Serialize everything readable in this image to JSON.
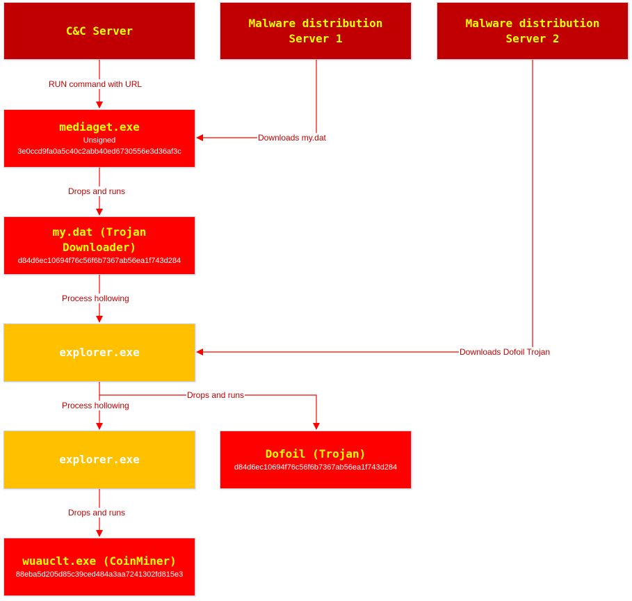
{
  "colors": {
    "server": "#c00000",
    "malware": "#ff0000",
    "process": "#ffc000",
    "title_text": "#ffff00",
    "process_title_text": "#ffffff",
    "hash_text": "#ffffff",
    "edge": "#ff0000",
    "edge_label": "#c00000"
  },
  "nodes": {
    "cc_server": {
      "title": "C&C Server"
    },
    "dist_server_1": {
      "title": "Malware distribution\nServer 1"
    },
    "dist_server_2": {
      "title": "Malware distribution\nServer 2"
    },
    "mediaget": {
      "title": "mediaget.exe",
      "signature": "Unsigned",
      "hash": "3e0ccd9fa0a5c40c2abb40ed6730556e3d36af3c"
    },
    "mydat": {
      "title": "my.dat (Trojan\nDownloader)",
      "hash": "d84d6ec10694f76c56f6b7367ab56ea1f743d284"
    },
    "explorer_1": {
      "title": "explorer.exe"
    },
    "explorer_2": {
      "title": "explorer.exe"
    },
    "dofoil": {
      "title": "Dofoil (Trojan)",
      "hash": "d84d6ec10694f76c56f6b7367ab56ea1f743d284"
    },
    "wuauclt": {
      "title": "wuauclt.exe (CoinMiner)",
      "hash": "88eba5d205d85c39ced484a3aa7241302fd815e3"
    }
  },
  "edges": [
    {
      "id": "cc-to-mediaget",
      "from": "cc_server",
      "to": "mediaget",
      "label": "RUN command with URL"
    },
    {
      "id": "dist1-to-mediaget",
      "from": "dist_server_1",
      "to": "mediaget",
      "label": "Downloads my.dat"
    },
    {
      "id": "mediaget-to-mydat",
      "from": "mediaget",
      "to": "mydat",
      "label": "Drops and runs"
    },
    {
      "id": "mydat-to-explorer1",
      "from": "mydat",
      "to": "explorer_1",
      "label": "Process hollowing"
    },
    {
      "id": "dist2-to-explorer1",
      "from": "dist_server_2",
      "to": "explorer_1",
      "label": "Downloads Dofoil Trojan"
    },
    {
      "id": "explorer1-to-explorer2",
      "from": "explorer_1",
      "to": "explorer_2",
      "label": "Process hollowing"
    },
    {
      "id": "explorer1-to-dofoil",
      "from": "explorer_1",
      "to": "dofoil",
      "label": "Drops and runs"
    },
    {
      "id": "explorer2-to-wuauclt",
      "from": "explorer_2",
      "to": "wuauclt",
      "label": "Drops and runs"
    }
  ]
}
